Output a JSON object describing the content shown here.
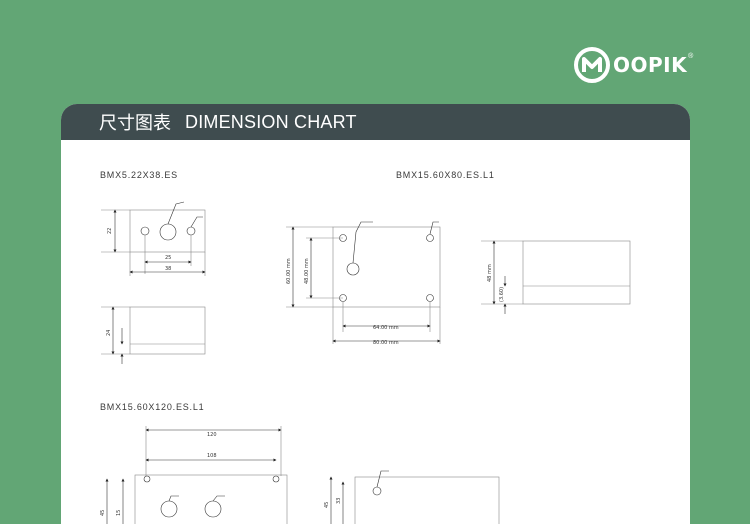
{
  "brand": {
    "name": "OOPIK",
    "mark": "M",
    "registered": "®"
  },
  "header": {
    "title_zh": "尺寸图表",
    "title_en": "DIMENSION CHART"
  },
  "models": {
    "a": "BMX5.22X38.ES",
    "b": "BMX15.60X80.ES.L1",
    "c": "BMX15.60X120.ES.L1"
  },
  "dims": {
    "a_height": "22",
    "a_inner": "25",
    "a_width": "38",
    "a_side": "24",
    "b_h1": "60.00 mm",
    "b_h2": "48.00 mm",
    "b_w1": "64.00 mm",
    "b_w2": "80.00 mm",
    "b_side1": "48 mm",
    "b_side2": "(3.60)",
    "c_w1": "120",
    "c_w2": "108",
    "c_h": "45",
    "c_h2": "33",
    "c_h3": "15"
  }
}
